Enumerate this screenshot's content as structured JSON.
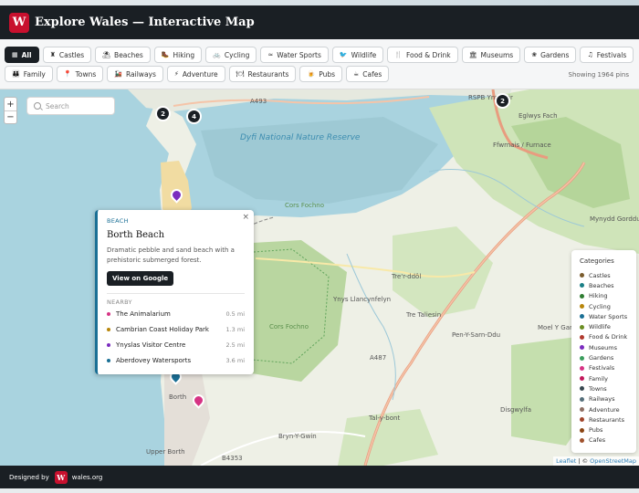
{
  "app": {
    "logo_letter": "W",
    "title": "Explore Wales — Interactive Map"
  },
  "filters": {
    "row1": [
      {
        "icon": "▦",
        "label": "All",
        "active": true
      },
      {
        "icon": "♜",
        "label": "Castles"
      },
      {
        "icon": "⛱",
        "label": "Beaches"
      },
      {
        "icon": "🥾",
        "label": "Hiking"
      },
      {
        "icon": "🚲",
        "label": "Cycling"
      },
      {
        "icon": "≈",
        "label": "Water Sports"
      },
      {
        "icon": "🐦",
        "label": "Wildlife"
      },
      {
        "icon": "🍴",
        "label": "Food & Drink"
      },
      {
        "icon": "🏛",
        "label": "Museums"
      },
      {
        "icon": "❀",
        "label": "Gardens"
      },
      {
        "icon": "♫",
        "label": "Festivals"
      }
    ],
    "row2": [
      {
        "icon": "👪",
        "label": "Family"
      },
      {
        "icon": "📍",
        "label": "Towns"
      },
      {
        "icon": "🚂",
        "label": "Railways"
      },
      {
        "icon": "⚡",
        "label": "Adventure"
      },
      {
        "icon": "🍽",
        "label": "Restaurants"
      },
      {
        "icon": "🍺",
        "label": "Pubs"
      },
      {
        "icon": "☕",
        "label": "Cafes"
      }
    ],
    "showing": "Showing 1964 pins"
  },
  "map": {
    "search_placeholder": "Search",
    "zoom_in": "+",
    "zoom_out": "−",
    "labels": {
      "estuary": "Dyfi National Nature Reserve",
      "bog": "Cors Fochno",
      "a493": "A493",
      "a487": "A487",
      "b4353": "B4353",
      "aspb": "RSPB Ynys-hir",
      "eglwys": "Eglwys Fach",
      "furnace": "Ffwrnais / Furnace",
      "tre_r_ddol": "Tre'r-ddôl",
      "llancynfelyn": "Ynys Llancynfelyn",
      "tre_taliesin": "Tre Taliesin",
      "pen_y_sarn": "Pen-Y-Sarn-Ddu",
      "moel": "Moel Y Garn",
      "mynydd": "Mynydd Gorddu",
      "borth": "Borth",
      "upper_borth": "Upper Borth",
      "bryn": "Bryn-Y-Gwin",
      "talybont": "Tal-y-bont",
      "disgwylfa": "Disgwylfa",
      "cors_fochno_label": "Cors Fochno",
      "cors_fochno_upper": "Cors Fochno"
    },
    "clusters": [
      "2",
      "4",
      "2"
    ],
    "attribution": {
      "leaflet": "Leaflet",
      "sep": " | © ",
      "osm": "OpenStreetMap"
    }
  },
  "popup": {
    "close": "×",
    "category": "BEACH",
    "title": "Borth Beach",
    "description": "Dramatic pebble and sand beach with a prehistoric submerged forest.",
    "button": "View on Google",
    "nearby_heading": "NEARBY",
    "nearby": [
      {
        "name": "The Animalarium",
        "distance": "0.5 mi",
        "color": "#d63384"
      },
      {
        "name": "Cambrian Coast Holiday Park",
        "distance": "1.3 mi",
        "color": "#b8860b"
      },
      {
        "name": "Ynyslas Visitor Centre",
        "distance": "2.5 mi",
        "color": "#7b2cbf"
      },
      {
        "name": "Aberdovey Watersports",
        "distance": "3.6 mi",
        "color": "#1a6f95"
      }
    ]
  },
  "legend": {
    "title": "Categories",
    "items": [
      {
        "label": "Castles",
        "color": "#7a5c2e"
      },
      {
        "label": "Beaches",
        "color": "#1a7f86"
      },
      {
        "label": "Hiking",
        "color": "#2e7d32"
      },
      {
        "label": "Cycling",
        "color": "#b8860b"
      },
      {
        "label": "Water Sports",
        "color": "#1a6f95"
      },
      {
        "label": "Wildlife",
        "color": "#6b8e23"
      },
      {
        "label": "Food & Drink",
        "color": "#b03a2e"
      },
      {
        "label": "Museums",
        "color": "#7b2cbf"
      },
      {
        "label": "Gardens",
        "color": "#3a9d5d"
      },
      {
        "label": "Festivals",
        "color": "#d63384"
      },
      {
        "label": "Family",
        "color": "#c2185b"
      },
      {
        "label": "Towns",
        "color": "#37474f"
      },
      {
        "label": "Railways",
        "color": "#546e7a"
      },
      {
        "label": "Adventure",
        "color": "#8d6e63"
      },
      {
        "label": "Restaurants",
        "color": "#a1452b"
      },
      {
        "label": "Pubs",
        "color": "#8b4513"
      },
      {
        "label": "Cafes",
        "color": "#a0522d"
      }
    ]
  },
  "footer": {
    "designed_by": "Designed by",
    "logo_letter": "W",
    "site": "wales.org"
  }
}
